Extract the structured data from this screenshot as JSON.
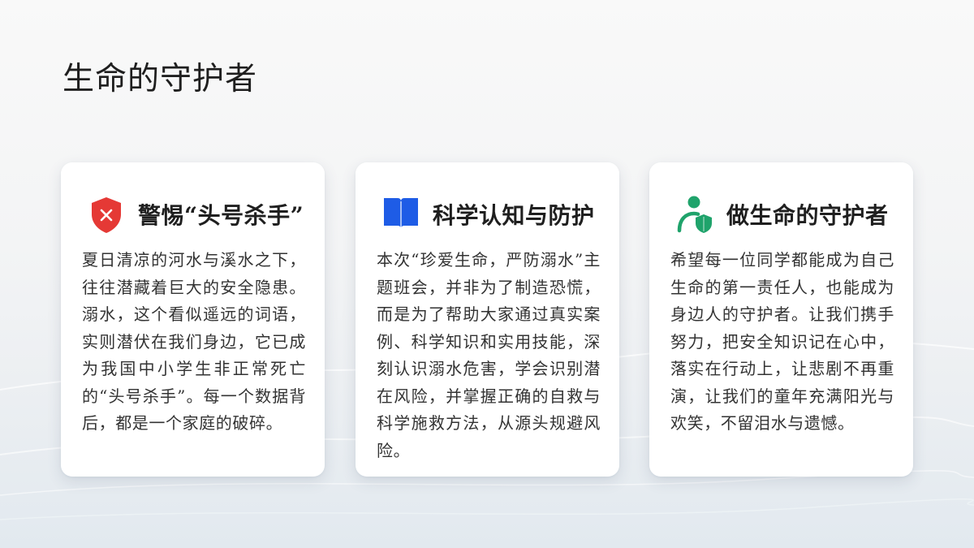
{
  "page": {
    "title": "生命的守护者"
  },
  "cards": [
    {
      "icon": "shield-x-icon",
      "icon_color": "#e53935",
      "title": "警惕“头号杀手”",
      "body": "夏日清凉的河水与溪水之下，往往潜藏着巨大的安全隐患。溺水，这个看似遥远的词语，实则潜伏在我们身边，它已成为我国中小学生非正常死亡的“头号杀手”。每一个数据背后，都是一个家庭的破碎。"
    },
    {
      "icon": "book-icon",
      "icon_color": "#1e5ce6",
      "title": "科学认知与防护",
      "body": "本次“珍爱生命，严防溺水”主题班会，并非为了制造恐慌，而是为了帮助大家通过真实案例、科学知识和实用技能，深刻认识溺水危害，学会识别潜在风险，并掌握正确的自救与科学施救方法，从源头规避风险。"
    },
    {
      "icon": "person-shield-icon",
      "icon_color": "#1fa36b",
      "title": "做生命的守护者",
      "body": "希望每一位同学都能成为自己生命的第一责任人，也能成为身边人的守护者。让我们携手努力，把安全知识记在心中，落实在行动上，让悲剧不再重演，让我们的童年充满阳光与欢笑，不留泪水与遗憾。"
    }
  ]
}
